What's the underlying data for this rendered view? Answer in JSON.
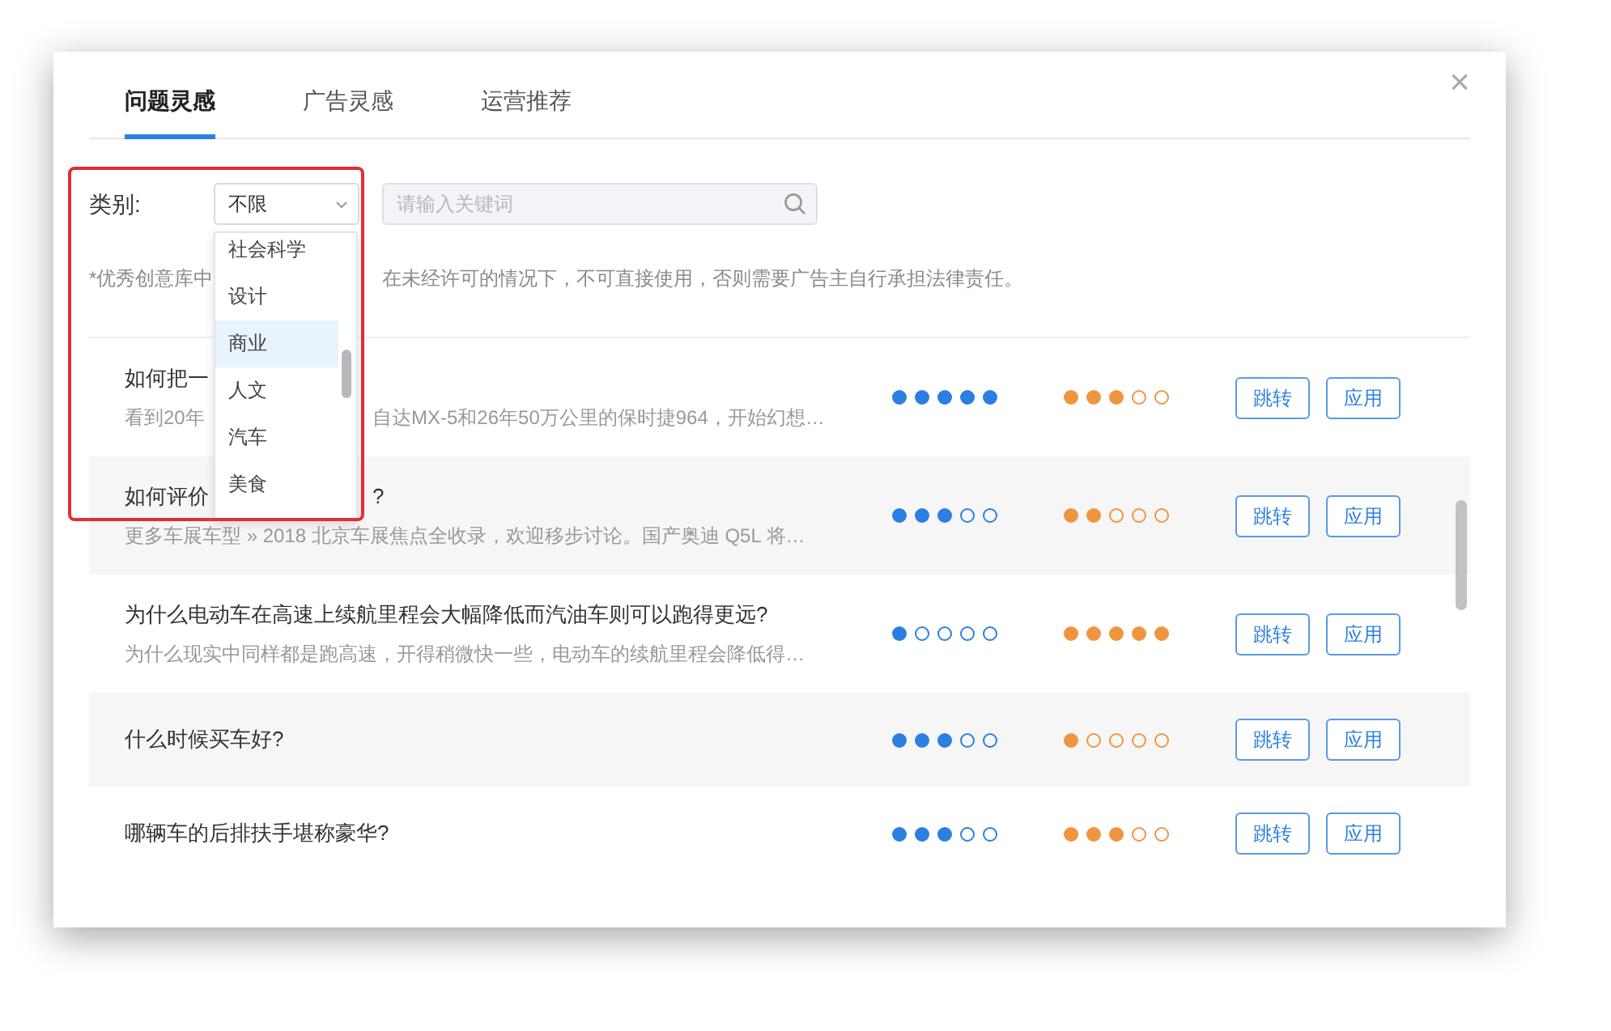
{
  "tabs": [
    {
      "label": "问题灵感",
      "selected": true
    },
    {
      "label": "广告灵感",
      "selected": false
    },
    {
      "label": "运营推荐",
      "selected": false
    }
  ],
  "close": "×",
  "filter": {
    "label": "类别:",
    "select_value": "不限",
    "search": {
      "placeholder": "请输入关键词"
    }
  },
  "dropdown": {
    "items": [
      {
        "label": "社会科学",
        "selected": false
      },
      {
        "label": "设计",
        "selected": false
      },
      {
        "label": "商业",
        "selected": true
      },
      {
        "label": "人文",
        "selected": false
      },
      {
        "label": "汽车",
        "selected": false
      },
      {
        "label": "美食",
        "selected": false
      }
    ]
  },
  "notice": [
    "*优秀创意库中",
    "在未经许可的情况下，不可直接使用，否则需要广告主自行承担法律责任。"
  ],
  "rows": [
    {
      "title": [
        "如何把一"
      ],
      "subtitle": [
        "看到20年",
        "自达MX-5和26年50万公里的保时捷964，开始幻想…"
      ],
      "rating_1": {
        "stars": 5
      },
      "rating_2": {
        "stars": 3
      },
      "buttons": [
        "跳转",
        "应用"
      ]
    },
    {
      "title": [
        "如何评价",
        "?"
      ],
      "subtitle": [
        "更多车展车型 » 2018 北京车展焦点全收录，欢迎移步讨论。国产奥迪 Q5L 将…"
      ],
      "rating_1": {
        "stars": 3
      },
      "rating_2": {
        "stars": 2
      },
      "buttons": [
        "跳转",
        "应用"
      ]
    },
    {
      "title": [
        "为什么电动车在高速上续航里程会大幅降低而汽油车则可以跑得更远?"
      ],
      "subtitle": [
        "为什么现实中同样都是跑高速，开得稍微快一些，电动车的续航里程会降低得…"
      ],
      "rating_1": {
        "stars": 1
      },
      "rating_2": {
        "stars": 5
      },
      "buttons": [
        "跳转",
        "应用"
      ]
    },
    {
      "title": [
        "什么时候买车好?"
      ],
      "rating_1": {
        "stars": 3
      },
      "rating_2": {
        "stars": 1
      },
      "buttons": [
        "跳转",
        "应用"
      ]
    },
    {
      "title": [
        "哪辆车的后排扶手堪称豪华?"
      ],
      "rating_1": {
        "stars": 3
      },
      "rating_2": {
        "stars": 3
      },
      "buttons": [
        "跳转",
        "应用"
      ]
    }
  ]
}
